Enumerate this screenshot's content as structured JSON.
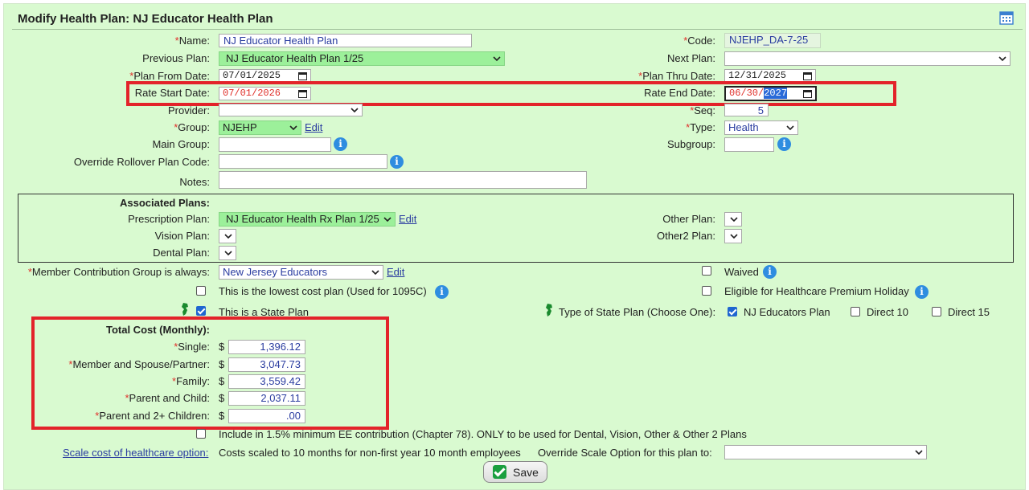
{
  "header": {
    "title": "Modify Health Plan: NJ Educator Health Plan",
    "icon": "calendar-grid-icon"
  },
  "fields": {
    "name": {
      "label": "Name:",
      "value": "NJ Educator Health Plan"
    },
    "code": {
      "label": "Code:",
      "value": "NJEHP_DA-7-25"
    },
    "previous_plan": {
      "label": "Previous Plan:",
      "value": "NJ Educator Health Plan 1/25"
    },
    "next_plan": {
      "label": "Next Plan:",
      "value": ""
    },
    "plan_from": {
      "label": "Plan From Date:",
      "value": "07/01/2025"
    },
    "plan_thru": {
      "label": "Plan Thru Date:",
      "value": "12/31/2025"
    },
    "rate_start": {
      "label": "Rate Start Date:",
      "value": "07/01/2026"
    },
    "rate_end": {
      "label": "Rate End Date:",
      "value_prefix": "06/30/",
      "value_selected": "2027"
    },
    "provider": {
      "label": "Provider:",
      "value": ""
    },
    "seq": {
      "label": "Seq:",
      "value": "5"
    },
    "group": {
      "label": "Group:",
      "value": "NJEHP",
      "edit": "Edit"
    },
    "type": {
      "label": "Type:",
      "value": "Health"
    },
    "main_group": {
      "label": "Main Group:",
      "value": ""
    },
    "subgroup": {
      "label": "Subgroup:",
      "value": ""
    },
    "override_rollover": {
      "label": "Override Rollover Plan Code:",
      "value": ""
    },
    "notes": {
      "label": "Notes:",
      "value": ""
    }
  },
  "associated": {
    "heading": "Associated Plans:",
    "prescription": {
      "label": "Prescription Plan:",
      "value": "NJ Educator Health Rx Plan 1/25",
      "edit": "Edit"
    },
    "vision": {
      "label": "Vision Plan:"
    },
    "dental": {
      "label": "Dental Plan:"
    },
    "other": {
      "label": "Other Plan:"
    },
    "other2": {
      "label": "Other2 Plan:"
    }
  },
  "member_contribution": {
    "label": "Member Contribution Group is always:",
    "value": "New Jersey Educators",
    "edit": "Edit"
  },
  "checks": {
    "waived": "Waived",
    "lowest_cost": "This is the lowest cost plan (Used for 1095C)",
    "premium_holiday": "Eligible for Healthcare Premium Holiday",
    "state_plan": "This is a State Plan",
    "type_state_plan": "Type of State Plan (Choose One):",
    "nj_educators": "NJ Educators Plan",
    "direct10": "Direct 10",
    "direct15": "Direct 15",
    "min_ee": "Include in 1.5% minimum EE contribution (Chapter 78). ONLY to be used for Dental, Vision, Other & Other 2 Plans"
  },
  "total_cost": {
    "heading": "Total Cost (Monthly):",
    "currency": "$",
    "rows": [
      {
        "label": "Single:",
        "value": "1,396.12"
      },
      {
        "label": "Member and Spouse/Partner:",
        "value": "3,047.73"
      },
      {
        "label": "Family:",
        "value": "3,559.42"
      },
      {
        "label": "Parent and Child:",
        "value": "2,037.11"
      },
      {
        "label": "Parent and 2+ Children:",
        "value": ".00"
      }
    ]
  },
  "scale": {
    "link": "Scale cost of healthcare option:",
    "text": "Costs scaled to 10 months for non-first year 10 month employees",
    "override_label": "Override Scale Option for this plan to:",
    "override_value": ""
  },
  "save_label": "Save",
  "required_mark": "*",
  "colors": {
    "background": "#d9fad0",
    "highlight_box": "#e3232a",
    "link": "#2a3ca0",
    "select_green": "#9cf09a"
  }
}
